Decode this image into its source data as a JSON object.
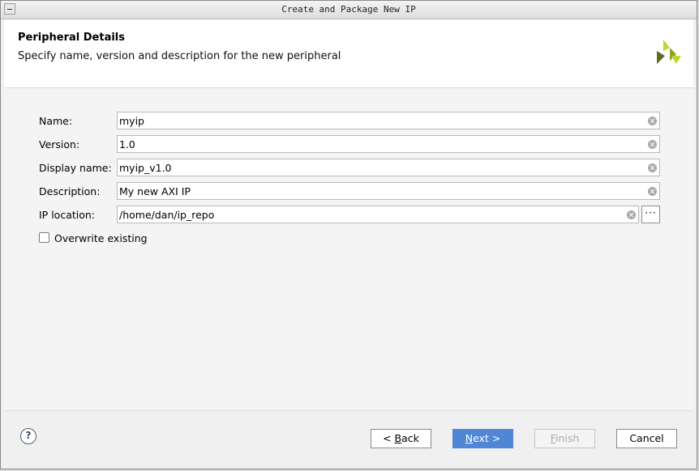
{
  "window": {
    "title": "Create and Package New IP"
  },
  "header": {
    "title": "Peripheral Details",
    "subtitle": "Specify name, version and description for the new peripheral"
  },
  "form": {
    "name": {
      "label": "Name:",
      "value": "myip"
    },
    "version": {
      "label": "Version:",
      "value": "1.0"
    },
    "display_name": {
      "label": "Display name:",
      "value": "myip_v1.0"
    },
    "description": {
      "label": "Description:",
      "value": "My new AXI IP"
    },
    "ip_location": {
      "label": "IP location:",
      "value": "/home/dan/ip_repo",
      "browse_label": "···"
    },
    "overwrite": {
      "label": "Overwrite existing",
      "checked": false
    }
  },
  "footer": {
    "help_label": "?",
    "back_prefix": "< ",
    "back_mnemonic": "B",
    "back_rest": "ack",
    "next_mnemonic": "N",
    "next_rest": "ext >",
    "finish_mnemonic": "F",
    "finish_rest": "inish",
    "cancel_label": "Cancel"
  },
  "colors": {
    "primary_button": "#4f86d6",
    "logo_light": "#c3d52a",
    "logo_dark": "#5f6b23"
  },
  "icons": {
    "logo": "xilinx-logo-icon",
    "clear": "clear-circle-x-icon",
    "help": "help-question-icon"
  }
}
